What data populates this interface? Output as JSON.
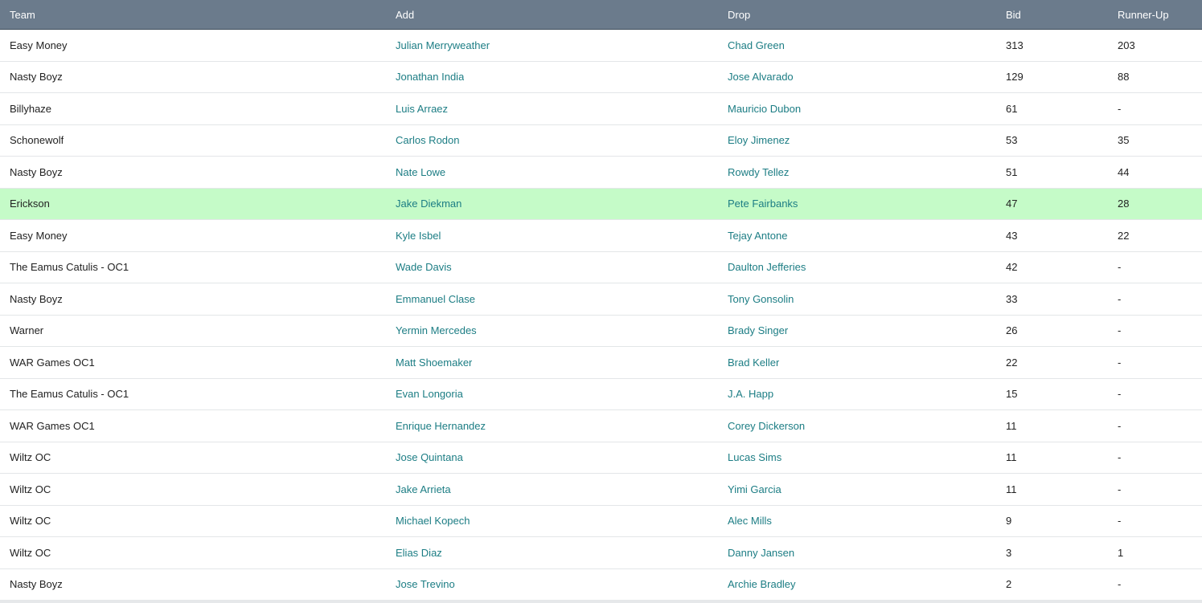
{
  "headers": {
    "team": "Team",
    "add": "Add",
    "drop": "Drop",
    "bid": "Bid",
    "runner_up": "Runner-Up"
  },
  "colors": {
    "header_bg": "#6b7b8c",
    "link": "#1c7d84",
    "highlight_row": "#c5fbc8"
  },
  "rows": [
    {
      "team": "Easy Money",
      "add": "Julian Merryweather",
      "drop": "Chad Green",
      "bid": "313",
      "runner_up": "203",
      "highlighted": false
    },
    {
      "team": "Nasty Boyz",
      "add": "Jonathan India",
      "drop": "Jose Alvarado",
      "bid": "129",
      "runner_up": "88",
      "highlighted": false
    },
    {
      "team": "Billyhaze",
      "add": "Luis Arraez",
      "drop": "Mauricio Dubon",
      "bid": "61",
      "runner_up": "-",
      "highlighted": false
    },
    {
      "team": "Schonewolf",
      "add": "Carlos Rodon",
      "drop": "Eloy Jimenez",
      "bid": "53",
      "runner_up": "35",
      "highlighted": false
    },
    {
      "team": "Nasty Boyz",
      "add": "Nate Lowe",
      "drop": "Rowdy Tellez",
      "bid": "51",
      "runner_up": "44",
      "highlighted": false
    },
    {
      "team": "Erickson",
      "add": "Jake Diekman",
      "drop": "Pete Fairbanks",
      "bid": "47",
      "runner_up": "28",
      "highlighted": true
    },
    {
      "team": "Easy Money",
      "add": "Kyle Isbel",
      "drop": "Tejay Antone",
      "bid": "43",
      "runner_up": "22",
      "highlighted": false
    },
    {
      "team": "The Eamus Catulis - OC1",
      "add": "Wade Davis",
      "drop": "Daulton Jefferies",
      "bid": "42",
      "runner_up": "-",
      "highlighted": false
    },
    {
      "team": "Nasty Boyz",
      "add": "Emmanuel Clase",
      "drop": "Tony Gonsolin",
      "bid": "33",
      "runner_up": "-",
      "highlighted": false
    },
    {
      "team": "Warner",
      "add": "Yermin Mercedes",
      "drop": "Brady Singer",
      "bid": "26",
      "runner_up": "-",
      "highlighted": false
    },
    {
      "team": "WAR Games OC1",
      "add": "Matt Shoemaker",
      "drop": "Brad Keller",
      "bid": "22",
      "runner_up": "-",
      "highlighted": false
    },
    {
      "team": "The Eamus Catulis - OC1",
      "add": "Evan Longoria",
      "drop": "J.A. Happ",
      "bid": "15",
      "runner_up": "-",
      "highlighted": false
    },
    {
      "team": "WAR Games OC1",
      "add": "Enrique Hernandez",
      "drop": "Corey Dickerson",
      "bid": "11",
      "runner_up": "-",
      "highlighted": false
    },
    {
      "team": "Wiltz OC",
      "add": "Jose Quintana",
      "drop": "Lucas Sims",
      "bid": "11",
      "runner_up": "-",
      "highlighted": false
    },
    {
      "team": "Wiltz OC",
      "add": "Jake Arrieta",
      "drop": "Yimi Garcia",
      "bid": "11",
      "runner_up": "-",
      "highlighted": false
    },
    {
      "team": "Wiltz OC",
      "add": "Michael Kopech",
      "drop": "Alec Mills",
      "bid": "9",
      "runner_up": "-",
      "highlighted": false
    },
    {
      "team": "Wiltz OC",
      "add": "Elias Diaz",
      "drop": "Danny Jansen",
      "bid": "3",
      "runner_up": "1",
      "highlighted": false
    },
    {
      "team": "Nasty Boyz",
      "add": "Jose Trevino",
      "drop": "Archie Bradley",
      "bid": "2",
      "runner_up": "-",
      "highlighted": false
    }
  ]
}
